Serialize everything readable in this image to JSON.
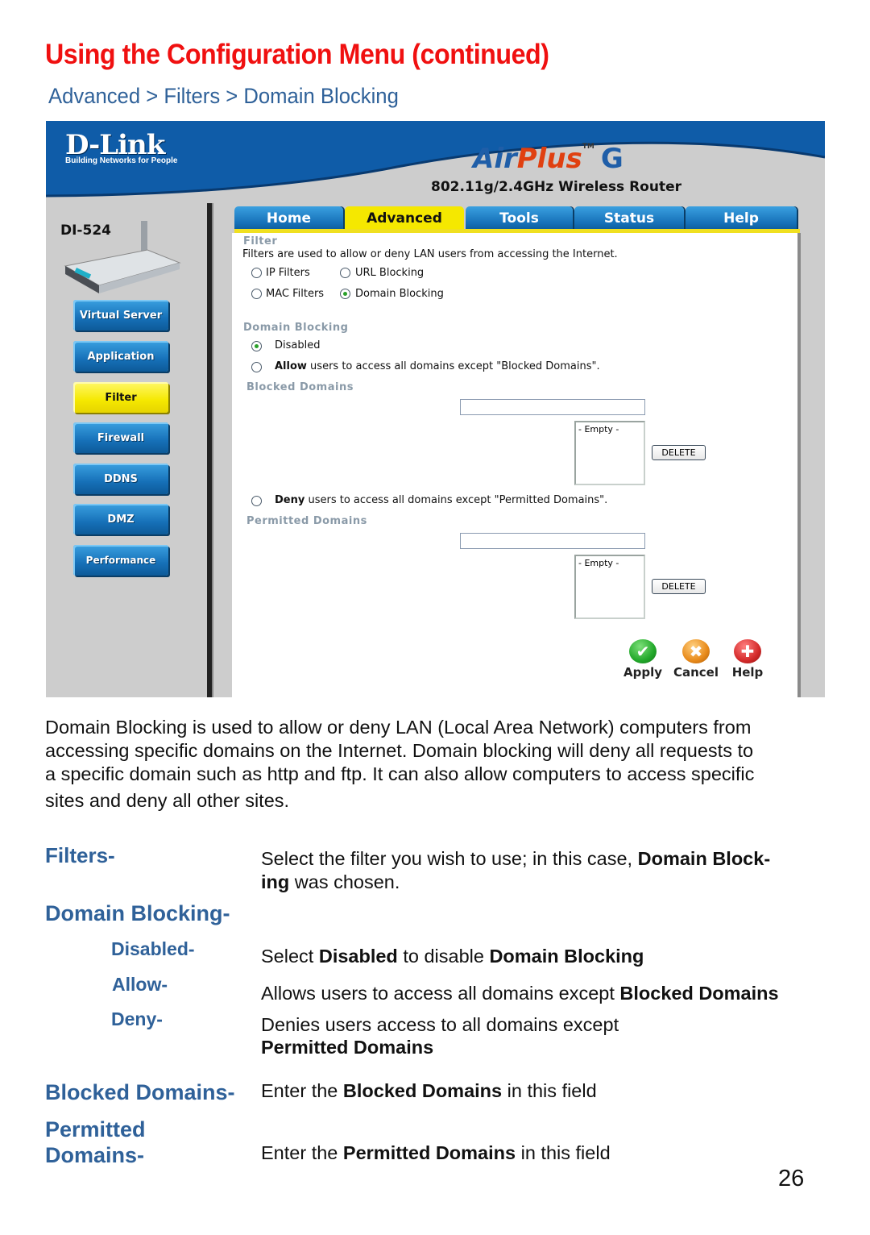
{
  "page": {
    "title": "Using the Configuration Menu  (continued)",
    "breadcrumb": "Advanced > Filters > Domain Blocking",
    "page_number": "26"
  },
  "router_ui": {
    "brand": "D-Link",
    "brand_tagline": "Building Networks for People",
    "product_logo": {
      "air": "Air",
      "plus": "Plus",
      "tm": "TM",
      "g": "G"
    },
    "product_subtitle": "802.11g/2.4GHz Wireless Router",
    "model": "DI-524",
    "colors": {
      "banner_blue": "#0f5ca8",
      "tab_blue": "#1670b8",
      "active_yellow": "#f5e800",
      "section_gray": "#8a9aa8"
    },
    "tabs": [
      {
        "label": "Home",
        "active": false
      },
      {
        "label": "Advanced",
        "active": true
      },
      {
        "label": "Tools",
        "active": false
      },
      {
        "label": "Status",
        "active": false
      },
      {
        "label": "Help",
        "active": false
      }
    ],
    "sidebar": [
      {
        "label": "Virtual Server",
        "active": false
      },
      {
        "label": "Application",
        "active": false
      },
      {
        "label": "Filter",
        "active": true
      },
      {
        "label": "Firewall",
        "active": false
      },
      {
        "label": "DDNS",
        "active": false
      },
      {
        "label": "DMZ",
        "active": false
      },
      {
        "label": "Performance",
        "active": false
      }
    ],
    "filter_section": {
      "title": "Filter",
      "description": "Filters are used to allow or deny LAN users from accessing the Internet.",
      "options": [
        {
          "label": "IP Filters",
          "selected": false
        },
        {
          "label": "URL Blocking",
          "selected": false
        },
        {
          "label": "MAC Filters",
          "selected": false
        },
        {
          "label": "Domain Blocking",
          "selected": true
        }
      ]
    },
    "domain_blocking": {
      "title": "Domain Blocking",
      "disabled_label": "Disabled",
      "disabled_selected": true,
      "allow_bold": "Allow",
      "allow_rest": " users to access all domains except \"Blocked Domains\".",
      "allow_selected": false,
      "blocked_title": "Blocked Domains",
      "blocked_input_value": "",
      "blocked_list_item": "- Empty -",
      "deny_bold": "Deny",
      "deny_rest": " users to access all domains except \"Permitted Domains\".",
      "deny_selected": false,
      "permitted_title": "Permitted Domains",
      "permitted_input_value": "",
      "permitted_list_item": "- Empty -",
      "delete_label": "DELETE"
    },
    "actions": [
      {
        "label": "Apply",
        "icon": "check-icon",
        "color": "#22a82a"
      },
      {
        "label": "Cancel",
        "icon": "x-icon",
        "color": "#e88a1a"
      },
      {
        "label": "Help",
        "icon": "plus-icon",
        "color": "#d42a2a"
      }
    ]
  },
  "body": {
    "intro_lines": [
      "Domain Blocking is used to allow or deny LAN (Local Area Network) computers from",
      "accessing specific domains on the Internet. Domain blocking will deny all requests to",
      "a specific domain such as http and ftp. It can also allow computers to access specific",
      "sites and deny all other sites."
    ],
    "terms": {
      "filters": {
        "label": "Filters-",
        "desc_1a": "Select the filter you wish to use; in this case, ",
        "desc_1b": "Domain Block-",
        "desc_2a": "ing",
        "desc_2b": " was chosen."
      },
      "domain_blocking": {
        "label": "Domain Blocking-"
      },
      "disabled": {
        "label": "Disabled-",
        "d1": "Select ",
        "d2": "Disabled",
        "d3": " to disable ",
        "d4": "Domain Blocking"
      },
      "allow": {
        "label": "Allow-",
        "d1": "Allows users to access all domains except ",
        "d2": "Blocked Domains"
      },
      "deny": {
        "label": "Deny-",
        "d1": "Denies users  access to  all domains except",
        "d2": "Permitted Domains"
      },
      "blocked_domains": {
        "label": "Blocked Domains-",
        "d1": "Enter the ",
        "d2": "Blocked Domains",
        "d3": " in this field"
      },
      "permitted_domains": {
        "label_1": "Permitted",
        "label_2": "Domains-",
        "d1": "Enter the ",
        "d2": "Permitted Domains",
        "d3": " in this field"
      }
    }
  }
}
